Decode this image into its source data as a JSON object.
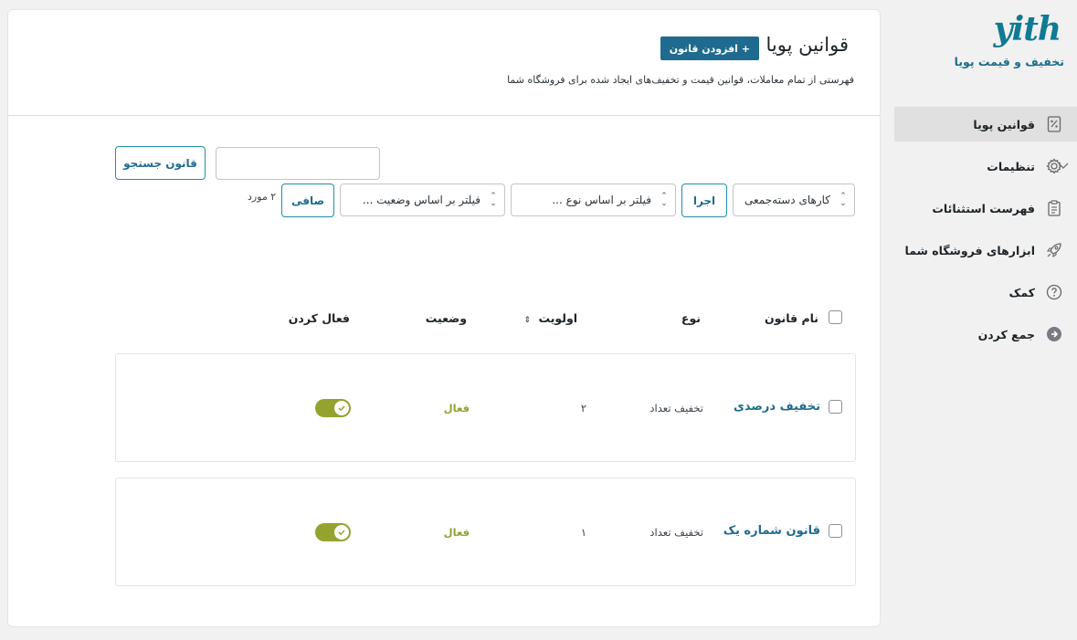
{
  "sidebar": {
    "logo": "yith",
    "brand_subtitle": "تخفیف و قیمت پویا",
    "items": [
      {
        "label": "قوانین پویا",
        "icon": "percent-doc-icon",
        "active": true
      },
      {
        "label": "تنظیمات",
        "icon": "gear-icon"
      },
      {
        "label": "فهرست استثنائات",
        "icon": "clipboard-icon"
      },
      {
        "label": "ابزارهای فروشگاه شما",
        "icon": "rocket-icon"
      },
      {
        "label": "کمک",
        "icon": "help-icon"
      },
      {
        "label": "جمع کردن",
        "icon": "collapse-arrow-icon"
      }
    ]
  },
  "header": {
    "title": "قوانین پویا",
    "add_button": "+ افزودن قانون",
    "subtitle": "فهرستی از تمام معاملات، قوانین قیمت و تخفیف‌های ایجاد شده برای فروشگاه شما"
  },
  "toolbar": {
    "search_button": "قانون جستجو",
    "bulk_actions": "کارهای دسته‌جمعی",
    "apply_button": "اجرا",
    "filter_type": "فیلتر بر اساس نوع ...",
    "filter_status": "فیلتر بر اساس وضعیت ...",
    "filter_button": "صافی",
    "count": "۲ مورد"
  },
  "table": {
    "headers": {
      "name": "نام قانون",
      "type": "نوع",
      "priority": "اولویت",
      "status": "وضعیت",
      "enable": "فعال کردن"
    },
    "rows": [
      {
        "name": "تخفیف درصدی",
        "type": "تخفیف تعداد",
        "priority": "۲",
        "status": "فعال",
        "enabled": true
      },
      {
        "name": "قانون شماره یک",
        "type": "تخفیف تعداد",
        "priority": "۱",
        "status": "فعال",
        "enabled": true
      }
    ]
  },
  "colors": {
    "accent": "#1f6b8f",
    "toggle_on": "#94a32f",
    "status_active": "#94a32f"
  }
}
